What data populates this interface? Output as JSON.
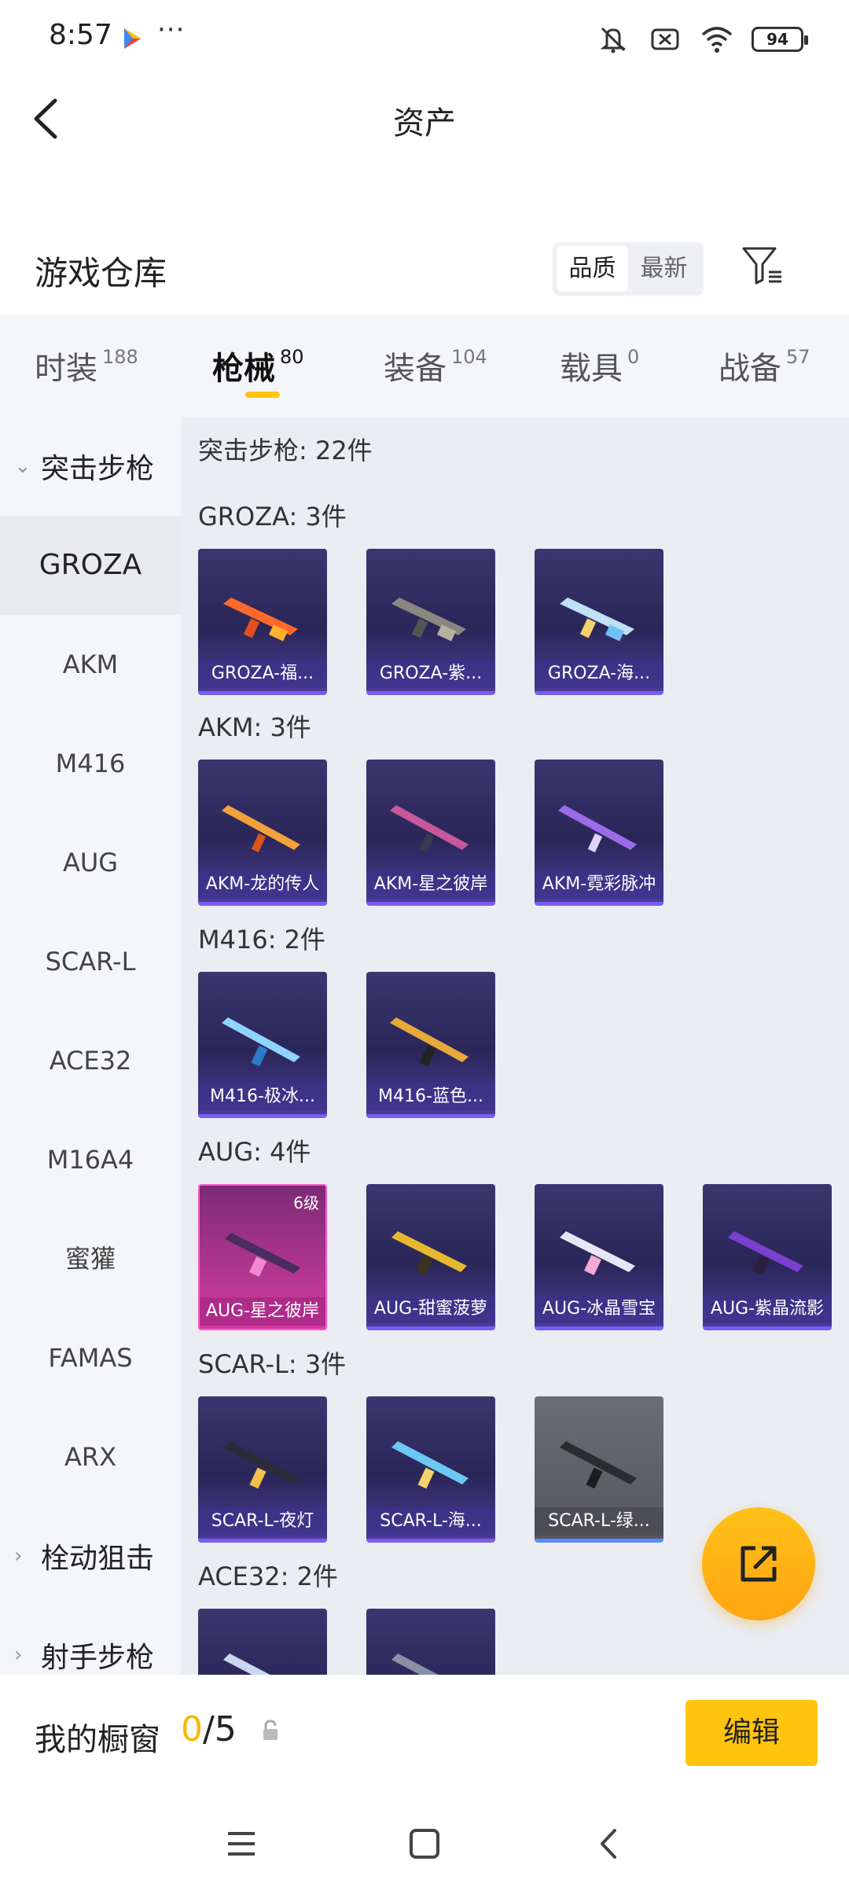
{
  "status_bar": {
    "time": "8:57",
    "more": "···",
    "battery": "94"
  },
  "header": {
    "title": "资产"
  },
  "warehouse": {
    "title": "游戏仓库",
    "sort_options": [
      "品质",
      "最新"
    ]
  },
  "categories": [
    {
      "label": "时装",
      "count": "188"
    },
    {
      "label": "枪械",
      "count": "80"
    },
    {
      "label": "装备",
      "count": "104"
    },
    {
      "label": "载具",
      "count": "0"
    },
    {
      "label": "战备",
      "count": "57"
    }
  ],
  "sidebar": {
    "group_assault": "突击步枪",
    "items": [
      "GROZA",
      "AKM",
      "M416",
      "AUG",
      "SCAR-L",
      "ACE32",
      "M16A4",
      "蜜獾",
      "FAMAS",
      "ARX"
    ],
    "group_bolt": "栓动狙击",
    "group_marksman": "射手步枪"
  },
  "content": {
    "summary": "突击步枪: 22件",
    "groups": [
      {
        "title": "GROZA: 3件",
        "items": [
          "GROZA-福...",
          "GROZA-紫...",
          "GROZA-海..."
        ]
      },
      {
        "title": "AKM: 3件",
        "items": [
          "AKM-龙的传人",
          "AKM-星之彼岸",
          "AKM-霓彩脉冲"
        ]
      },
      {
        "title": "M416: 2件",
        "items": [
          "M416-极冰...",
          "M416-蓝色..."
        ]
      },
      {
        "title": "AUG: 4件",
        "items": [
          "AUG-星之彼岸",
          "AUG-甜蜜菠萝",
          "AUG-冰晶雪宝",
          "AUG-紫晶流影"
        ],
        "level_badge": "6级"
      },
      {
        "title": "SCAR-L: 3件",
        "items": [
          "SCAR-L-夜灯",
          "SCAR-L-海...",
          "SCAR-L-绿..."
        ]
      },
      {
        "title": "ACE32: 2件"
      }
    ]
  },
  "showcase": {
    "title": "我的橱窗",
    "current": "0",
    "total": "/5",
    "edit_label": "编辑"
  },
  "colors": {
    "accent": "#ffc40e",
    "card_bg": "#2a2658",
    "card_border": "#7a5cf0",
    "highlight_card": "#d43ba0"
  }
}
